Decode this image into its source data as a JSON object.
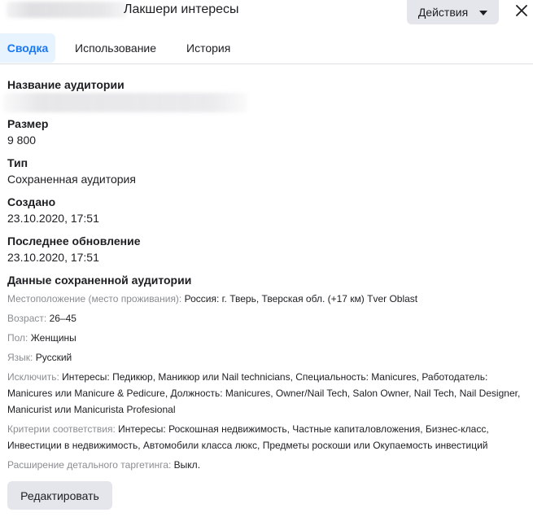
{
  "header": {
    "title": "Лакшери интересы",
    "actions_label": "Действия"
  },
  "tabs": [
    {
      "label": "Сводка"
    },
    {
      "label": "Использование"
    },
    {
      "label": "История"
    }
  ],
  "summary": {
    "name_label": "Название аудитории",
    "size_label": "Размер",
    "size_value": "9 800",
    "type_label": "Тип",
    "type_value": "Сохраненная аудитория",
    "created_label": "Создано",
    "created_value": "23.10.2020, 17:51",
    "updated_label": "Последнее обновление",
    "updated_value": "23.10.2020, 17:51",
    "saved_data_label": "Данные сохраненной аудитории"
  },
  "details": {
    "location_key": "Местоположение (место проживания):",
    "location_value": "Россия: г. Тверь, Тверская обл. (+17 км) Tver Oblast",
    "age_key": "Возраст:",
    "age_value": "26–45",
    "gender_key": "Пол:",
    "gender_value": "Женщины",
    "language_key": "Язык:",
    "language_value": "Русский",
    "exclude_key": "Исключить:",
    "exclude_value": "Интересы: Педикюр, Маникюр или Nail technicians, Специальность: Manicures, Работодатель: Manicures или Manicure & Pedicure, Должность: Manicures, Owner/Nail Tech, Salon Owner, Nail Tech, Nail Designer, Manicurist или Manicurista Profesional",
    "criteria_key": "Критерии соответствия:",
    "criteria_value": "Интересы: Роскошная недвижимость, Частные капиталовложения, Бизнес-класс, Инвестиции в недвижимость, Автомобили класса люкс, Предметы роскоши или Окупаемость инвестиций",
    "expansion_key": "Расширение детального таргетинга:",
    "expansion_value": "Выкл."
  },
  "edit_label": "Редактировать",
  "colors": {
    "accent": "#1877f2",
    "active_tab_bg": "#e7f3ff",
    "button_bg": "#e4e6eb",
    "muted_text": "#8a8d91"
  },
  "icons": {
    "actions_caret": "caret-down-icon",
    "close": "close-icon"
  }
}
